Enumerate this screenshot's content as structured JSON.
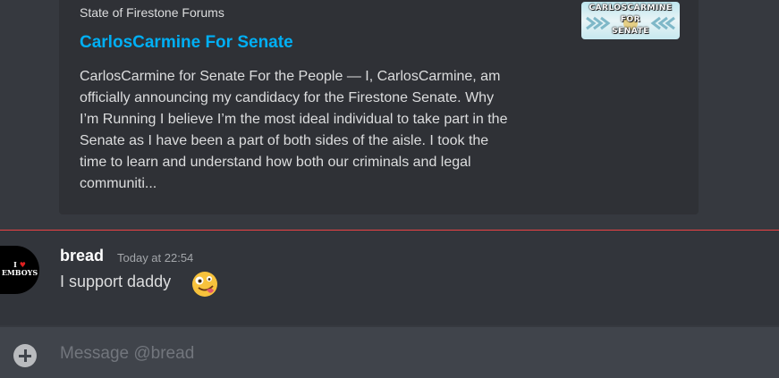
{
  "embed": {
    "provider": "State of Firestone Forums",
    "title": "CarlosCarmine For Senate",
    "description_lines": [
      "CarlosCarmine for Senate For the People — I, CarlosCarmine, am",
      "officially announcing my candidacy for the Firestone Senate. Why",
      "I’m Running I believe I’m the most ideal individual to take part in the",
      "Senate as I have been a part of both sides of the aisle. I took the",
      "time to learn and understand how both our criminals and legal",
      "communiti..."
    ],
    "thumbnail": {
      "line1": "CARLOSCARMINE",
      "line2": "FOR",
      "line3": "SENATE"
    }
  },
  "message": {
    "author": "bread",
    "timestamp": "Today at 22:54",
    "content": "I support daddy",
    "emoji": "zany-face-emoji",
    "avatar": {
      "line1": "I",
      "heart": "♥",
      "line2": "EMBOYS"
    }
  },
  "composer": {
    "placeholder": "Message @bread"
  },
  "colors": {
    "background": "#36393f",
    "embed_background": "#2f3136",
    "link": "#00aff4",
    "new_message_divider": "#ed4245",
    "composer_background": "#40444b"
  }
}
